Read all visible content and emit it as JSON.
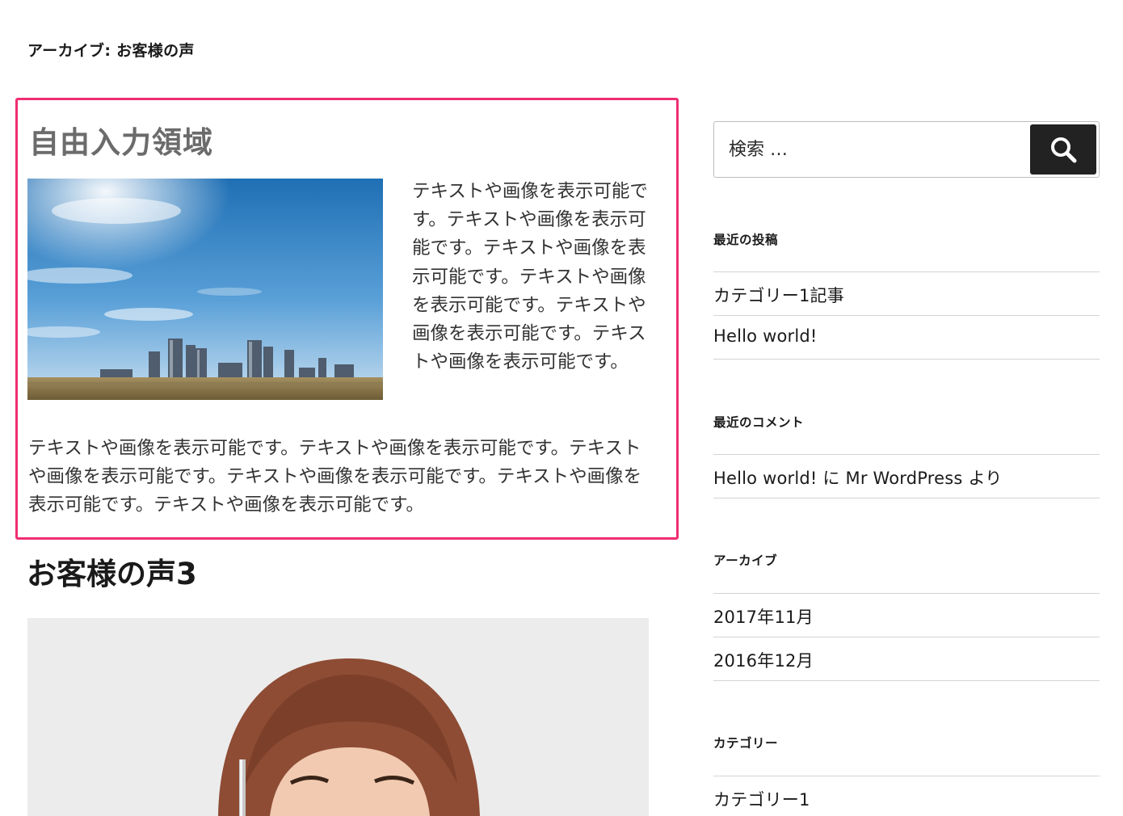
{
  "archive": {
    "title": "アーカイブ: お客様の声"
  },
  "free_area": {
    "title": "自由入力領域",
    "side_text": "テキストや画像を表示可能です。テキストや画像を表示可能です。テキストや画像を表示可能です。テキストや画像を表示可能です。テキストや画像を表示可能です。テキストや画像を表示可能です。",
    "bottom_text": "テキストや画像を表示可能です。テキストや画像を表示可能です。テキストや画像を表示可能です。テキストや画像を表示可能です。テキストや画像を表示可能です。テキストや画像を表示可能です。"
  },
  "post": {
    "title": "お客様の声3"
  },
  "sidebar": {
    "search": {
      "placeholder": "検索 …",
      "button_icon": "search-icon"
    },
    "recent_posts": {
      "title": "最近の投稿",
      "items": [
        "カテゴリー1記事",
        "Hello world!"
      ]
    },
    "recent_comments": {
      "title": "最近のコメント",
      "items": [
        "Hello world! に Mr WordPress より"
      ]
    },
    "archives": {
      "title": "アーカイブ",
      "items": [
        "2017年11月",
        "2016年12月"
      ]
    },
    "categories": {
      "title": "カテゴリー",
      "items": [
        "カテゴリー1"
      ]
    }
  },
  "colors": {
    "highlight_border": "#ef2e72",
    "search_button": "#222222"
  }
}
